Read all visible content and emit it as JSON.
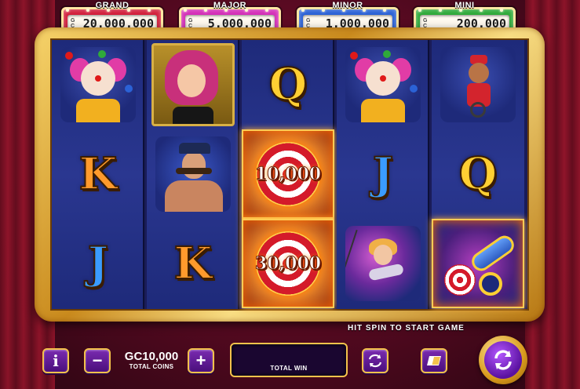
{
  "jackpots": [
    {
      "label": "GRAND",
      "currency": "G C",
      "value": "20.000.000",
      "color": "#d21f3c"
    },
    {
      "label": "MAJOR",
      "currency": "G C",
      "value": "5.000.000",
      "color": "#d42fb8"
    },
    {
      "label": "MINOR",
      "currency": "G C",
      "value": "1.000.000",
      "color": "#2b62d6"
    },
    {
      "label": "MINI",
      "currency": "G C",
      "value": "200.000",
      "color": "#2faa3a"
    }
  ],
  "reels": [
    [
      {
        "symbol": "clown-icon"
      },
      {
        "symbol": "K",
        "color": "orange"
      },
      {
        "symbol": "J",
        "color": "blue"
      }
    ],
    [
      {
        "symbol": "ringmaster-lady-icon"
      },
      {
        "symbol": "strongman-icon"
      },
      {
        "symbol": "K",
        "color": "orange"
      }
    ],
    [
      {
        "symbol": "Q",
        "color": "gold"
      },
      {
        "symbol": "target-icon",
        "prize": "10,000"
      },
      {
        "symbol": "target-icon",
        "prize": "30,000"
      }
    ],
    [
      {
        "symbol": "clown-icon"
      },
      {
        "symbol": "J",
        "color": "blue"
      },
      {
        "symbol": "acrobat-icon"
      }
    ],
    [
      {
        "symbol": "monkey-unicycle-icon"
      },
      {
        "symbol": "Q",
        "color": "gold"
      },
      {
        "symbol": "cannon-icon"
      }
    ]
  ],
  "status_message": "HIT SPIN TO START GAME",
  "controls": {
    "info_label": "i",
    "minus_label": "−",
    "plus_label": "+",
    "coins_value": "GC10,000",
    "coins_label": "TOTAL COINS",
    "total_win_label": "TOTAL WIN",
    "autoplay_icon": "autoplay-icon",
    "turbo_icon": "turbo-icon",
    "spin_icon": "spin-icon"
  }
}
